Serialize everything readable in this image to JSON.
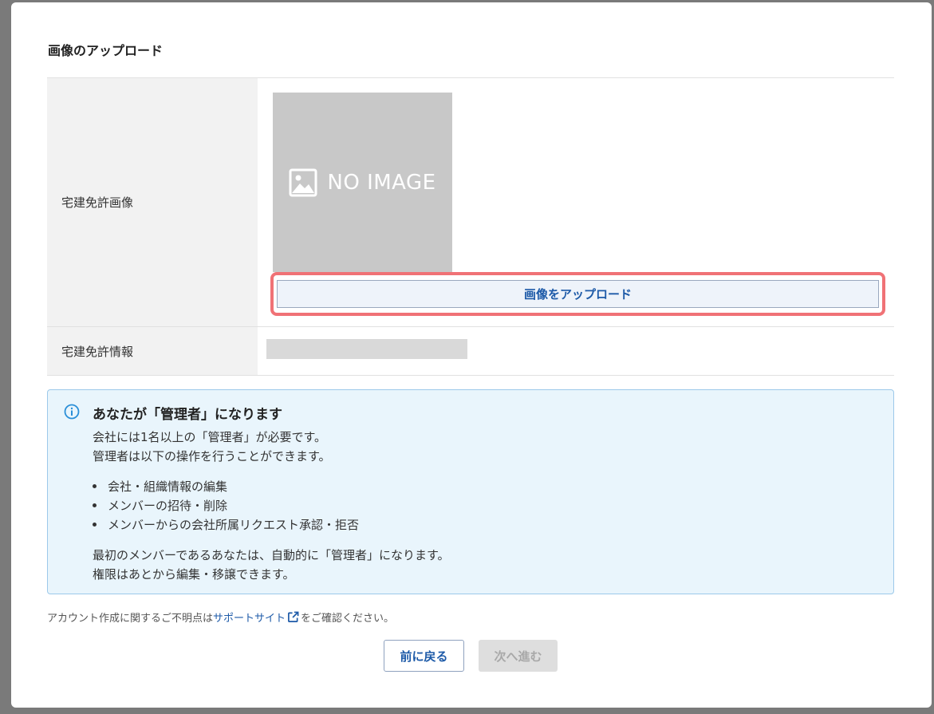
{
  "section": {
    "title": "画像のアップロード"
  },
  "form": {
    "license_image_label": "宅建免許画像",
    "placeholder_text": "NO IMAGE",
    "upload_button_label": "画像をアップロード",
    "license_info_label": "宅建免許情報"
  },
  "info": {
    "title": "あなたが「管理者」になります",
    "lines": [
      "会社には1名以上の「管理者」が必要です。",
      "管理者は以下の操作を行うことができます。"
    ],
    "bullets": [
      "会社・組織情報の編集",
      "メンバーの招待・削除",
      "メンバーからの会社所属リクエスト承認・拒否"
    ],
    "closing": [
      "最初のメンバーであるあなたは、自動的に「管理者」になります。",
      "権限はあとから編集・移譲できます。"
    ]
  },
  "footnote": {
    "prefix": "アカウント作成に関するご不明点は",
    "link": "サポートサイト",
    "suffix": "をご確認ください。"
  },
  "nav": {
    "back_label": "前に戻る",
    "next_label": "次へ進む"
  },
  "colors": {
    "accent": "#1d5aa8",
    "highlight": "#f07276",
    "info_bg": "#e9f5fc",
    "info_icon": "#2a8fd8"
  },
  "icons": {
    "image": "image-icon",
    "info": "info-icon",
    "external": "external-link-icon"
  }
}
